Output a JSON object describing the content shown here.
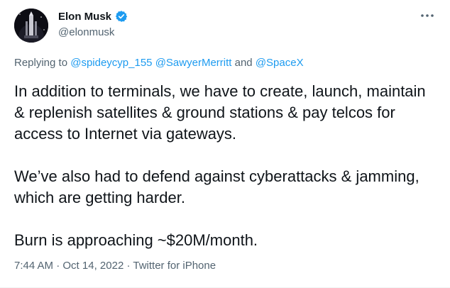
{
  "author": {
    "display_name": "Elon Musk",
    "handle": "@elonmusk",
    "verified_icon": "verified-badge-icon"
  },
  "more_icon": "more-options-icon",
  "reply": {
    "prefix": "Replying to ",
    "mentions": [
      "@spideycyp_155",
      "@SawyerMerritt",
      "@SpaceX"
    ],
    "conjunction": " and "
  },
  "tweet": {
    "paragraphs": [
      "In addition to terminals, we have to create, launch, maintain & replenish satellites & ground stations & pay telcos for access to Internet via gateways.",
      "We’ve also had to defend against cyberattacks & jamming, which are getting harder.",
      "Burn is approaching ~$20M/month."
    ]
  },
  "meta": {
    "time": "7:44 AM",
    "separator": " · ",
    "date": "Oct 14, 2022",
    "source": "Twitter for iPhone"
  },
  "colors": {
    "text": "#0f1419",
    "secondary": "#536471",
    "accent": "#1d9bf0"
  }
}
